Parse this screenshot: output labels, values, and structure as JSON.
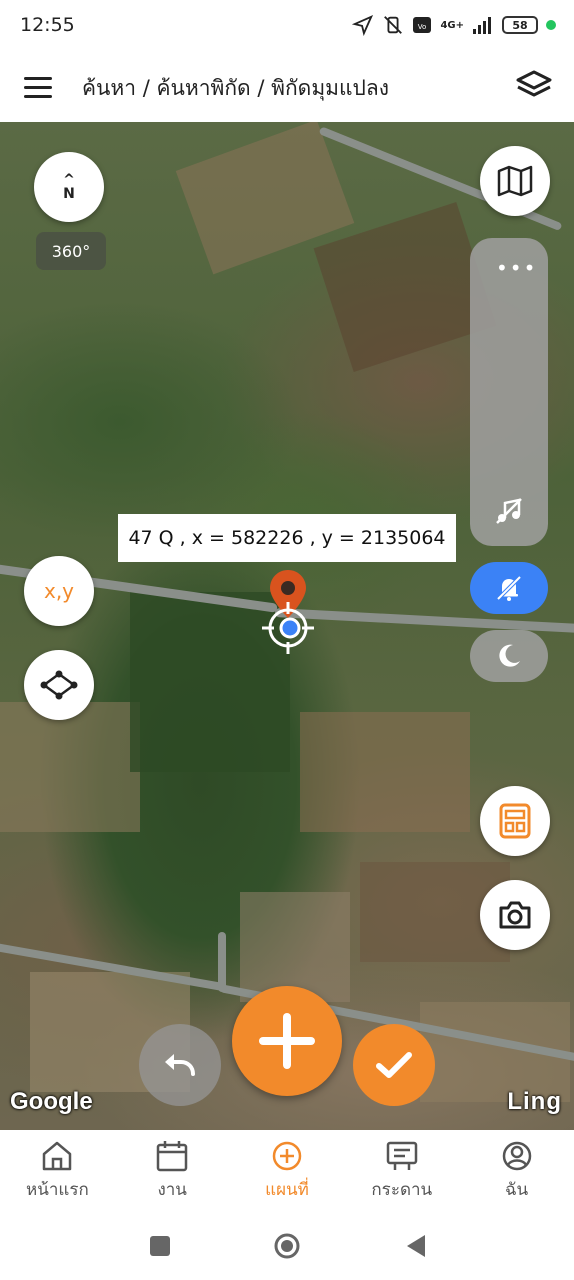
{
  "status_bar": {
    "time": "12:55",
    "battery": "58",
    "network": "4G+",
    "icons": [
      "location-arrow-icon",
      "vibrate-off-icon",
      "volte-icon",
      "signal-icon",
      "battery-icon",
      "notification-dot-icon"
    ]
  },
  "header": {
    "breadcrumb": "ค้นหา / ค้นหาพิกัด / พิกัดมุมแปลง",
    "menu_icon": "hamburger-menu-icon",
    "layers_icon": "layers-icon"
  },
  "map": {
    "compass_label": "N",
    "rotation": "360°",
    "coordinate_readout": "47 Q , x = 582226 , y = 2135064",
    "xy_button": "x,y",
    "attribution_left": "Google",
    "attribution_right": "Ling",
    "accent_color": "#f28a2b",
    "blue_color": "#3b82f6"
  },
  "bottom_nav": {
    "items": [
      {
        "label": "หน้าแรก",
        "icon": "home-icon"
      },
      {
        "label": "งาน",
        "icon": "calendar-icon"
      },
      {
        "label": "แผนที่",
        "icon": "add-circle-icon"
      },
      {
        "label": "กระดาน",
        "icon": "board-icon"
      },
      {
        "label": "ฉัน",
        "icon": "user-icon"
      }
    ],
    "active": "แผนที่"
  }
}
